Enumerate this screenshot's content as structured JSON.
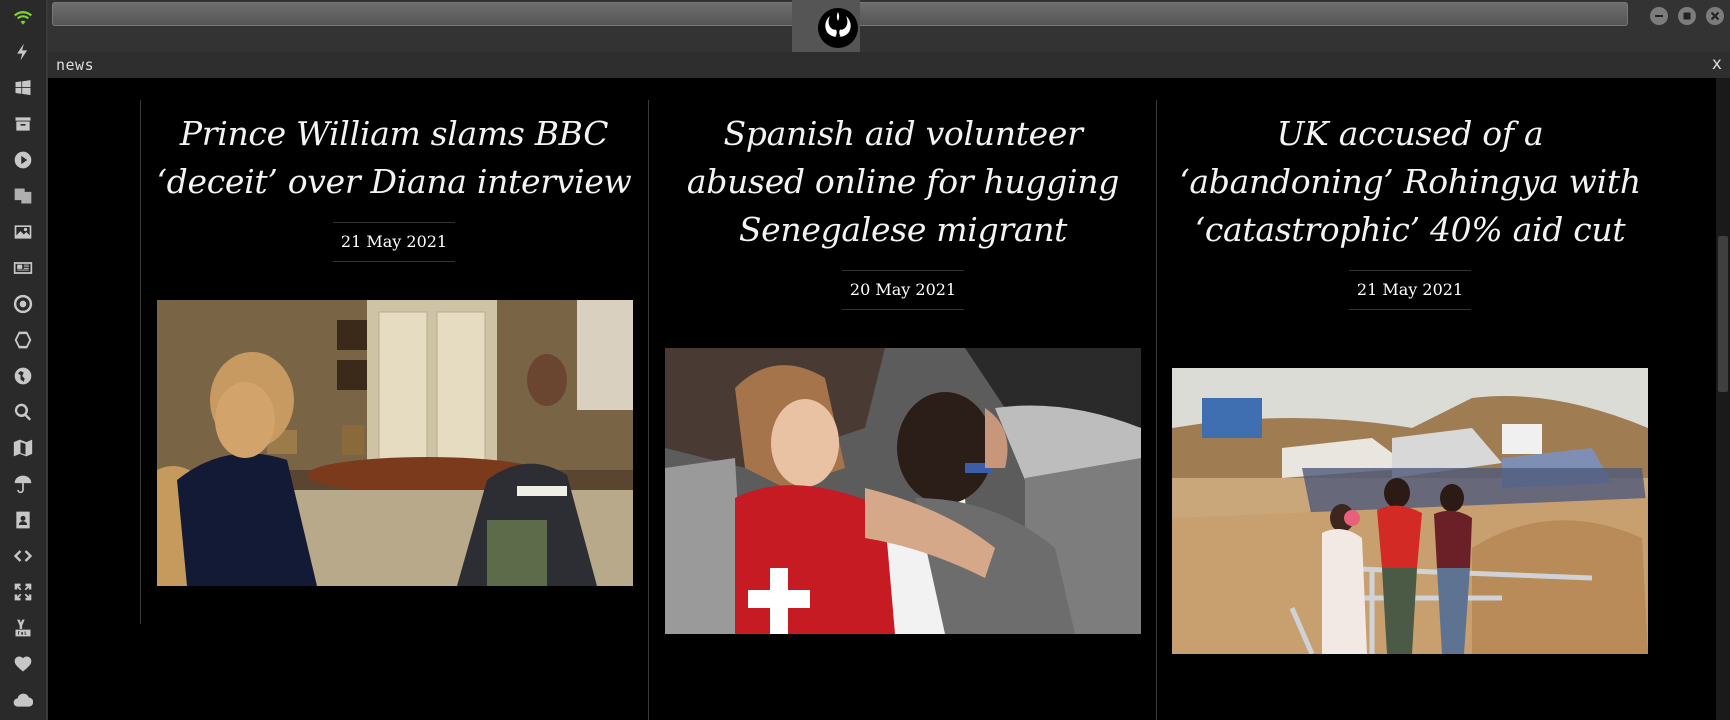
{
  "window": {
    "panel_title": "news",
    "close_label": "x"
  },
  "dock": {
    "icons": [
      "wifi-icon",
      "bolt-icon",
      "windows-icon",
      "archive-icon",
      "play-icon",
      "translate-icon",
      "image-icon",
      "newspaper-icon",
      "empire-icon",
      "hexagon-icon",
      "globe-icon",
      "search-icon",
      "map-icon",
      "umbrella-icon",
      "contacts-icon",
      "code-icon",
      "expand-icon",
      "youtube-icon",
      "heart-icon",
      "cloud-icon"
    ],
    "wifi_color": "#7cd02b"
  },
  "articles": [
    {
      "headline": "Prince William slams BBC ‘deceit’ over Diana interview",
      "date": "21 May 2021"
    },
    {
      "headline": "Spanish aid volunteer abused online for hugging Senegalese migrant",
      "date": "20 May 2021"
    },
    {
      "headline": "UK accused of a ‘abandoning’ Rohingya with ‘catastrophic’ 40% aid cut",
      "date": "21 May 2021"
    }
  ]
}
